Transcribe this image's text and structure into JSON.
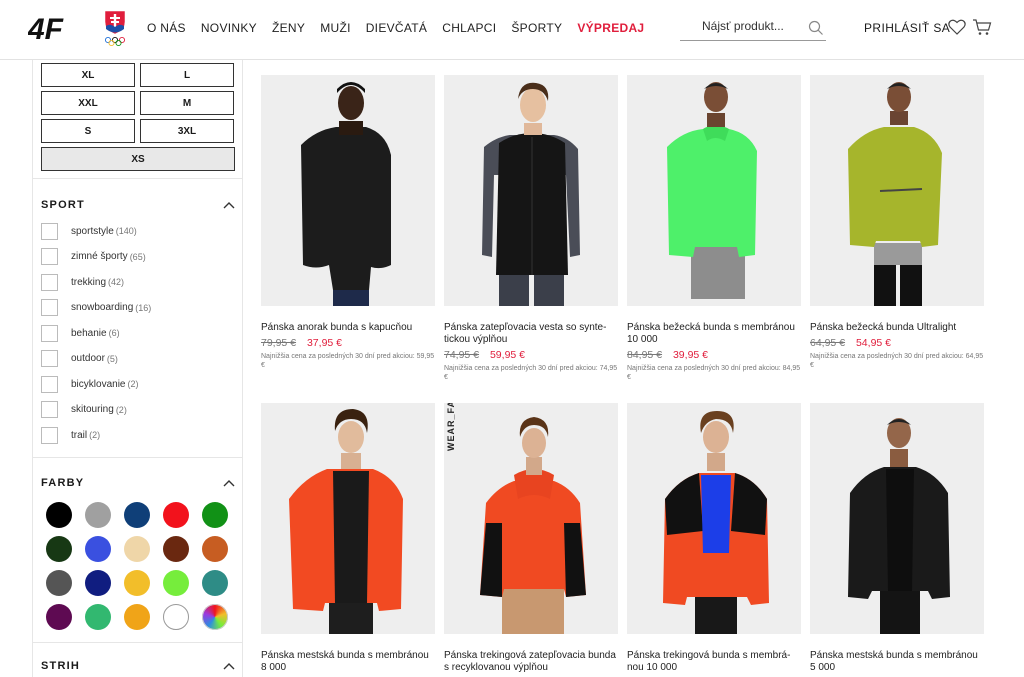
{
  "header": {
    "nav": [
      "O NÁS",
      "NOVINKY",
      "ŽENY",
      "MUŽI",
      "DIEVČATÁ",
      "CHLAPCI",
      "ŠPORTY",
      "VÝPREDAJ"
    ],
    "search_placeholder": "Nájsť produkt...",
    "login_label": "PRIHLÁSIŤ SA",
    "accent_color": "#e01e3c",
    "logo_text": "4F"
  },
  "sidebar": {
    "sizes": [
      "XL",
      "L",
      "XXL",
      "M",
      "S",
      "3XL",
      "XS"
    ],
    "sport_title": "SPORT",
    "sports": [
      {
        "label": "sportstyle",
        "count": "(140)"
      },
      {
        "label": "zimné športy",
        "count": "(65)"
      },
      {
        "label": "trekking",
        "count": "(42)"
      },
      {
        "label": "snowboarding",
        "count": "(16)"
      },
      {
        "label": "behanie",
        "count": "(6)"
      },
      {
        "label": "outdoor",
        "count": "(5)"
      },
      {
        "label": "bicyklovanie",
        "count": "(2)"
      },
      {
        "label": "skitouring",
        "count": "(2)"
      },
      {
        "label": "trail",
        "count": "(2)"
      }
    ],
    "colors_title": "FARBY",
    "colors": [
      "#000000",
      "#a0a0a0",
      "#0f3f78",
      "#f2121c",
      "#119116",
      "#173814",
      "#3a50e0",
      "#efd6a8",
      "#6a2810",
      "#c75d22",
      "#555555",
      "#101d80",
      "#f2be2a",
      "#76ed3c",
      "#2e8c86",
      "#5e0a52",
      "#32b870",
      "#f0a418",
      "#ffffff",
      "multicolor"
    ],
    "cut_title": "STRIH"
  },
  "products": [
    {
      "name": "Pánska anorak bunda s kapucňou",
      "old_price": "79,95 €",
      "new_price": "37,95 €",
      "lowest_text": "Najnižšia cena za posledných 30 dní pred akciou: 59,95 €",
      "jacket_color": "#1c1c1c"
    },
    {
      "name": "Pánska zatepľovacia vesta so synte-tickou výplňou",
      "old_price": "74,95 €",
      "new_price": "59,95 €",
      "lowest_text": "Najnižšia cena za posledných 30 dní pred akciou: 74,95 €",
      "jacket_color": "#151515"
    },
    {
      "name": "Pánska bežecká bunda s membránou 10 000",
      "old_price": "84,95 €",
      "new_price": "39,95 €",
      "lowest_text": "Najnižšia cena za posledných 30 dní pred akciou: 84,95 €",
      "jacket_color": "#4ef06a"
    },
    {
      "name": "Pánska bežecká bunda Ultralight",
      "old_price": "64,95 €",
      "new_price": "54,95 €",
      "lowest_text": "Najnižšia cena za posledných 30 dní pred akciou: 64,95 €",
      "jacket_color": "#a6b52c"
    },
    {
      "name": "Pánska mestská bunda s membránou 8 000",
      "old_price": "",
      "new_price": "",
      "lowest_text": "",
      "jacket_color": "#f24a22"
    },
    {
      "name": "Pánska trekingová zatepľovacia bunda s recyklovanou výplňou",
      "old_price": "",
      "new_price": "",
      "lowest_text": "",
      "jacket_color": "#f04a22",
      "tag": "WEAR_FAIR"
    },
    {
      "name": "Pánska trekingová bunda s membrá-nou 10 000",
      "old_price": "",
      "new_price": "",
      "lowest_text": "",
      "jacket_color": "#f04a22"
    },
    {
      "name": "Pánska mestská bunda s membránou 5 000",
      "old_price": "",
      "new_price": "",
      "lowest_text": "",
      "jacket_color": "#1a1a1a"
    }
  ]
}
